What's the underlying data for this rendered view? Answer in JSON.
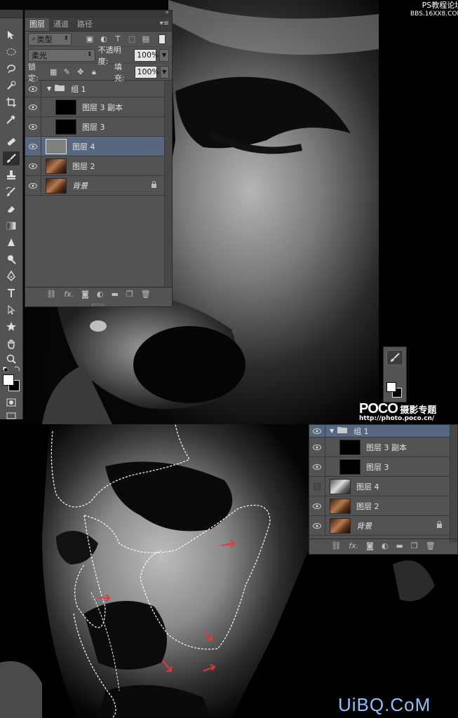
{
  "watermarks": {
    "top_right_line1": "PS教程论坛",
    "top_right_line2": "BBS.16XX8.COM",
    "poco_logo": "POCO",
    "poco_title": "摄影专题",
    "poco_url": "http://photo.poco.cn/",
    "uibq": "UiBQ.CoM"
  },
  "layers_panel": {
    "tabs": [
      {
        "label": "图层"
      },
      {
        "label": "通道"
      },
      {
        "label": "路径"
      }
    ],
    "filter_label": "类型",
    "blend_mode": "柔光",
    "opacity_label": "不透明度:",
    "opacity_value": "100%",
    "lock_label": "锁定:",
    "fill_label": "填充:",
    "fill_value": "100%",
    "layers": [
      {
        "name": "组 1",
        "type": "group",
        "visible": true
      },
      {
        "name": "图层 3 副本",
        "type": "black",
        "visible": true
      },
      {
        "name": "图层 3",
        "type": "black",
        "visible": true
      },
      {
        "name": "图层 4",
        "type": "gray",
        "visible": true,
        "selected": true
      },
      {
        "name": "图层 2",
        "type": "photo",
        "visible": true
      },
      {
        "name": "背景",
        "type": "photo",
        "visible": true,
        "locked": true
      }
    ],
    "footer_fx": "fx."
  },
  "layers_panel_lower": {
    "layers": [
      {
        "name": "组 1",
        "type": "group",
        "visible": true
      },
      {
        "name": "图层 3 副本",
        "type": "black",
        "visible": true
      },
      {
        "name": "图层 3",
        "type": "black",
        "visible": true
      },
      {
        "name": "图层 4",
        "type": "photo-gray",
        "visible": false
      },
      {
        "name": "图层 2",
        "type": "photo",
        "visible": true
      },
      {
        "name": "背景",
        "type": "photo",
        "visible": true,
        "locked": true
      }
    ],
    "footer_fx": "fx."
  },
  "colors": {
    "panel_bg": "#535353",
    "selected_row": "#56677f",
    "arrow_red": "#e23a3a"
  }
}
